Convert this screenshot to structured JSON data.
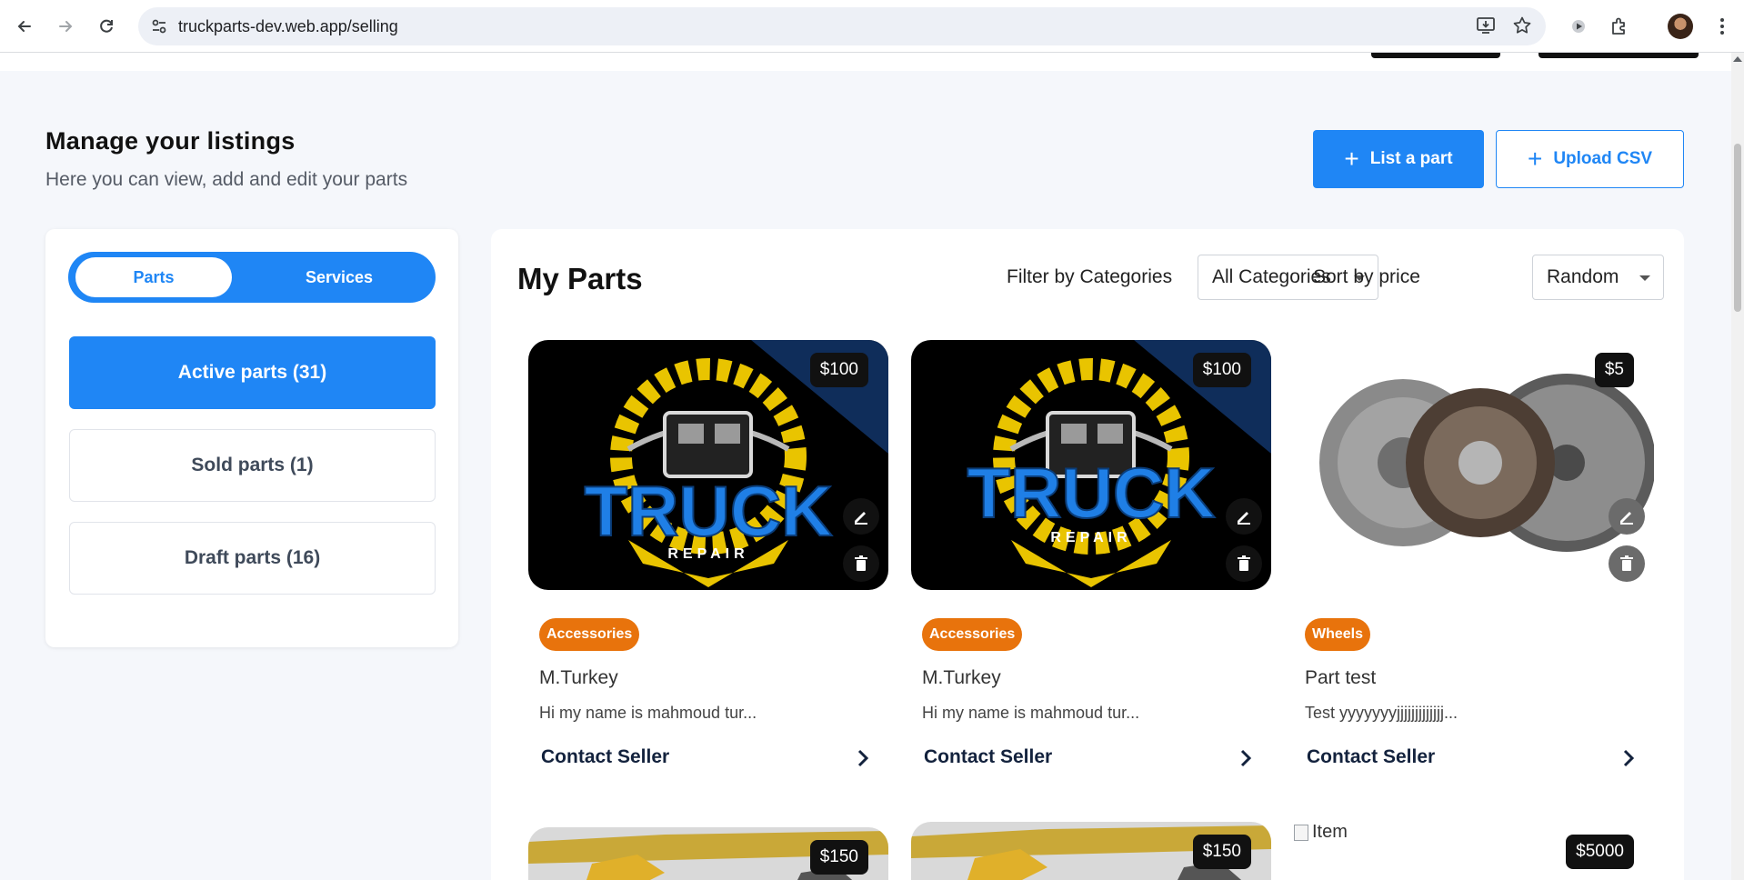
{
  "browser": {
    "url": "truckparts-dev.web.app/selling"
  },
  "header": {
    "title": "Manage your listings",
    "subtitle": "Here you can view, add and edit your parts",
    "list_part_label": "List a part",
    "upload_csv_label": "Upload CSV"
  },
  "sidebar": {
    "toggle": {
      "parts_label": "Parts",
      "services_label": "Services",
      "selected": "Parts"
    },
    "status_items": [
      {
        "label": "Active parts (31)",
        "active": true
      },
      {
        "label": "Sold parts (1)",
        "active": false
      },
      {
        "label": "Draft parts (16)",
        "active": false
      }
    ]
  },
  "main": {
    "title": "My Parts",
    "filter_label": "Filter by Categories",
    "filter_value": "All Categories",
    "sort_label": "Sort by price",
    "sort_value": "Random",
    "cards": [
      {
        "price": "$100",
        "category": "Accessories",
        "title": "M.Turkey",
        "description": "Hi my name is mahmoud tur...",
        "contact_label": "Contact Seller",
        "image": "truck-repair-logo",
        "logo_text": "TRUCK",
        "logo_subtext": "REPAIR"
      },
      {
        "price": "$100",
        "category": "Accessories",
        "title": "M.Turkey",
        "description": "Hi my name is mahmoud tur...",
        "contact_label": "Contact Seller",
        "image": "truck-repair-logo",
        "logo_text": "TRUCK",
        "logo_subtext": "REPAIR"
      },
      {
        "price": "$5",
        "category": "Wheels",
        "title": "Part test",
        "description": "Test yyyyyyyjjjjjjjjjjjjj...",
        "contact_label": "Contact Seller",
        "image": "clutch-kit-photo"
      }
    ],
    "cards_row2": [
      {
        "price": "$150",
        "image": "yellow-part-photo"
      },
      {
        "price": "$150",
        "image": "yellow-part-photo"
      },
      {
        "price": "$5000",
        "image_alt": "Item"
      }
    ]
  },
  "colors": {
    "primary": "#1f86f5",
    "category_badge": "#e8730c",
    "heading": "#111111"
  },
  "icons": [
    "back-arrow-icon",
    "forward-arrow-icon",
    "reload-icon",
    "site-info-icon",
    "install-icon",
    "bookmark-star-icon",
    "media-icon",
    "extensions-icon",
    "kebab-menu-icon",
    "plus-icon",
    "pencil-icon",
    "trash-icon",
    "chevron-right-icon"
  ]
}
